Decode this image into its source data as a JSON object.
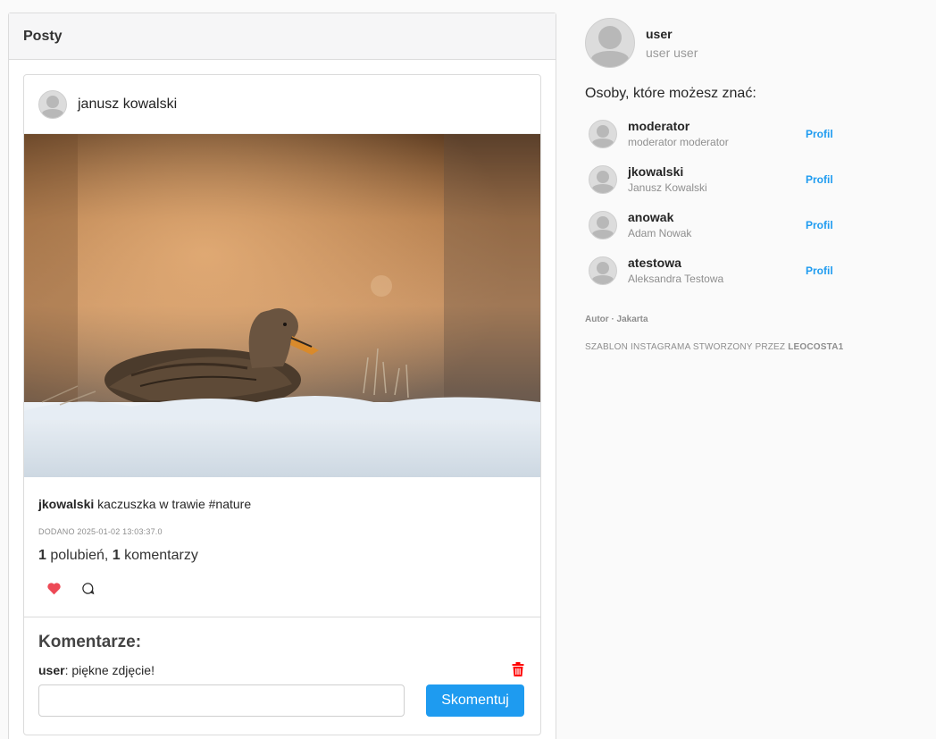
{
  "posts": {
    "header": "Posty",
    "post": {
      "author": "janusz kowalski",
      "image_alt": "",
      "caption_user": "jkowalski",
      "caption_text": "kaczuszka w trawie #nature",
      "date": "DODANO 2025-01-02 13:03:37.0",
      "likes_count": "1",
      "likes_label": "polubień,",
      "comments_count": "1",
      "comments_label": "komentarzy",
      "like_icon": "heart-icon",
      "comment_icon": "comment-icon",
      "comments": {
        "title": "Komentarze:",
        "items": [
          {
            "user": "user",
            "text": ": piękne zdjęcie!"
          }
        ],
        "input_value": "",
        "input_placeholder": "",
        "submit_label": "Skomentuj"
      }
    }
  },
  "sidebar": {
    "current_user": {
      "username": "user",
      "full_name": "user user"
    },
    "suggest_title": "Osoby, które możesz znać:",
    "suggestions": [
      {
        "username": "moderator",
        "full_name": "moderator moderator",
        "link": "Profil"
      },
      {
        "username": "jkowalski",
        "full_name": "Janusz Kowalski",
        "link": "Profil"
      },
      {
        "username": "anowak",
        "full_name": "Adam Nowak",
        "link": "Profil"
      },
      {
        "username": "atestowa",
        "full_name": "Aleksandra Testowa",
        "link": "Profil"
      }
    ],
    "footer_author": "Autor · Jakarta",
    "footer_credit_prefix": "SZABLON INSTAGRAMA STWORZONY PRZEZ ",
    "footer_credit_name": "LEOCOSTA1"
  },
  "colors": {
    "accent": "#1e9bf0",
    "like": "#ed4956",
    "delete": "#ff0000"
  }
}
